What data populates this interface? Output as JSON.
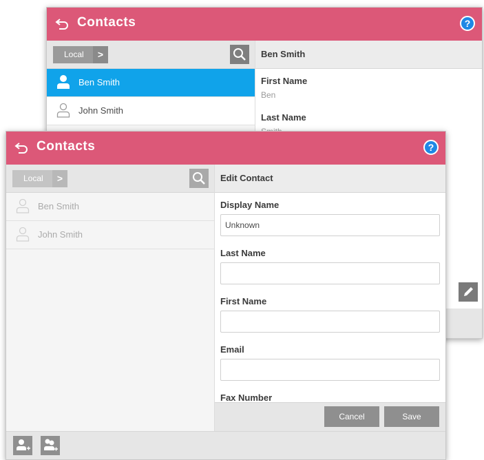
{
  "back_window": {
    "title": "Contacts",
    "help": "?",
    "source_button": "Local",
    "source_chevron": ">",
    "contacts": [
      "Ben Smith",
      "John Smith"
    ],
    "detail_header": "Ben Smith",
    "fields": [
      {
        "label": "First Name",
        "value": "Ben"
      },
      {
        "label": "Last Name",
        "value": "Smith"
      }
    ]
  },
  "front_window": {
    "title": "Contacts",
    "help": "?",
    "source_button": "Local",
    "source_chevron": ">",
    "contacts": [
      "Ben Smith",
      "John Smith"
    ],
    "editor_header": "Edit Contact",
    "fields": [
      {
        "label": "Display Name",
        "value": "Unknown"
      },
      {
        "label": "Last Name",
        "value": ""
      },
      {
        "label": "First Name",
        "value": ""
      },
      {
        "label": "Email",
        "value": ""
      },
      {
        "label": "Fax Number",
        "value": ""
      }
    ],
    "cancel_label": "Cancel",
    "save_label": "Save"
  },
  "colors": {
    "titlebar": "#dc5878",
    "selected_row": "#10a3ea",
    "help_icon": "#1e88e5"
  }
}
